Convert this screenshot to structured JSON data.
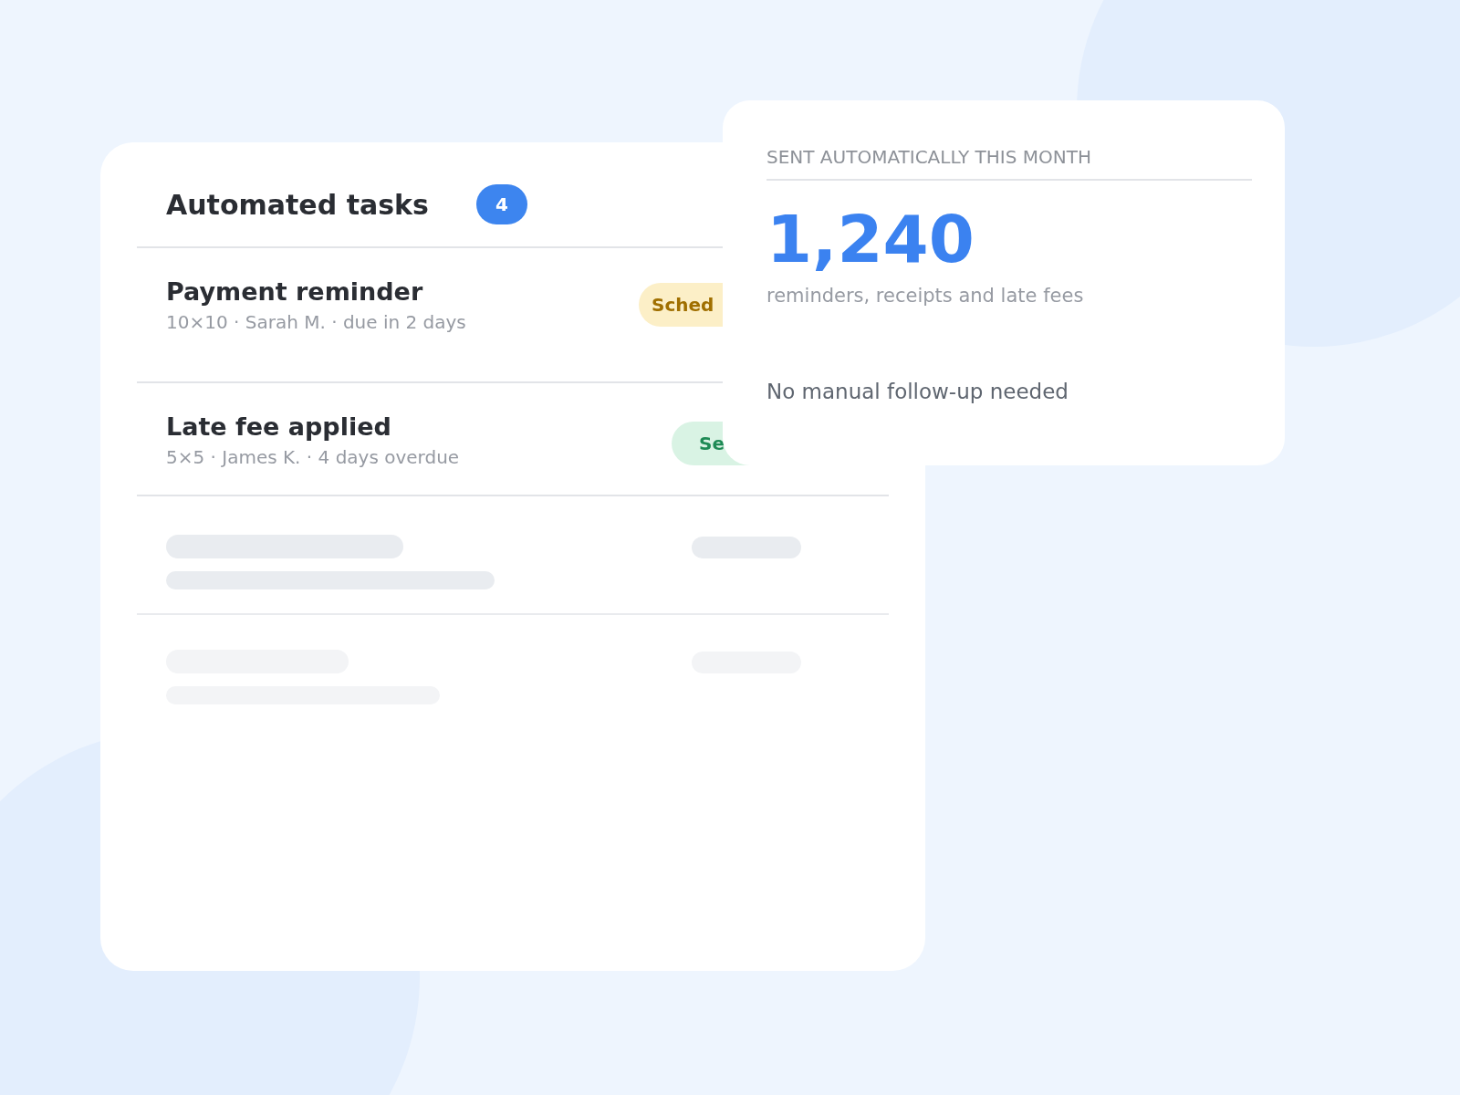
{
  "tasks_card": {
    "title": "Automated tasks",
    "count": "4",
    "rows": [
      {
        "title": "Payment reminder",
        "detail": "10×10 · Sarah M. · due in 2 days",
        "status": "Sched",
        "kind": "warning"
      },
      {
        "title": "Late fee applied",
        "detail": "5×5 · James K. · 4 days overdue",
        "status": "Se",
        "kind": "success"
      }
    ],
    "skeleton_rows": [
      {
        "kind": "skeleton",
        "color": "#e9ecf0"
      },
      {
        "kind": "skeleton",
        "color": "#f3f4f6"
      }
    ]
  },
  "stats_card": {
    "heading": "SENT AUTOMATICALLY THIS MONTH",
    "value": "1,240",
    "caption": "reminders, receipts and late fees",
    "note": "No manual follow-up needed"
  }
}
